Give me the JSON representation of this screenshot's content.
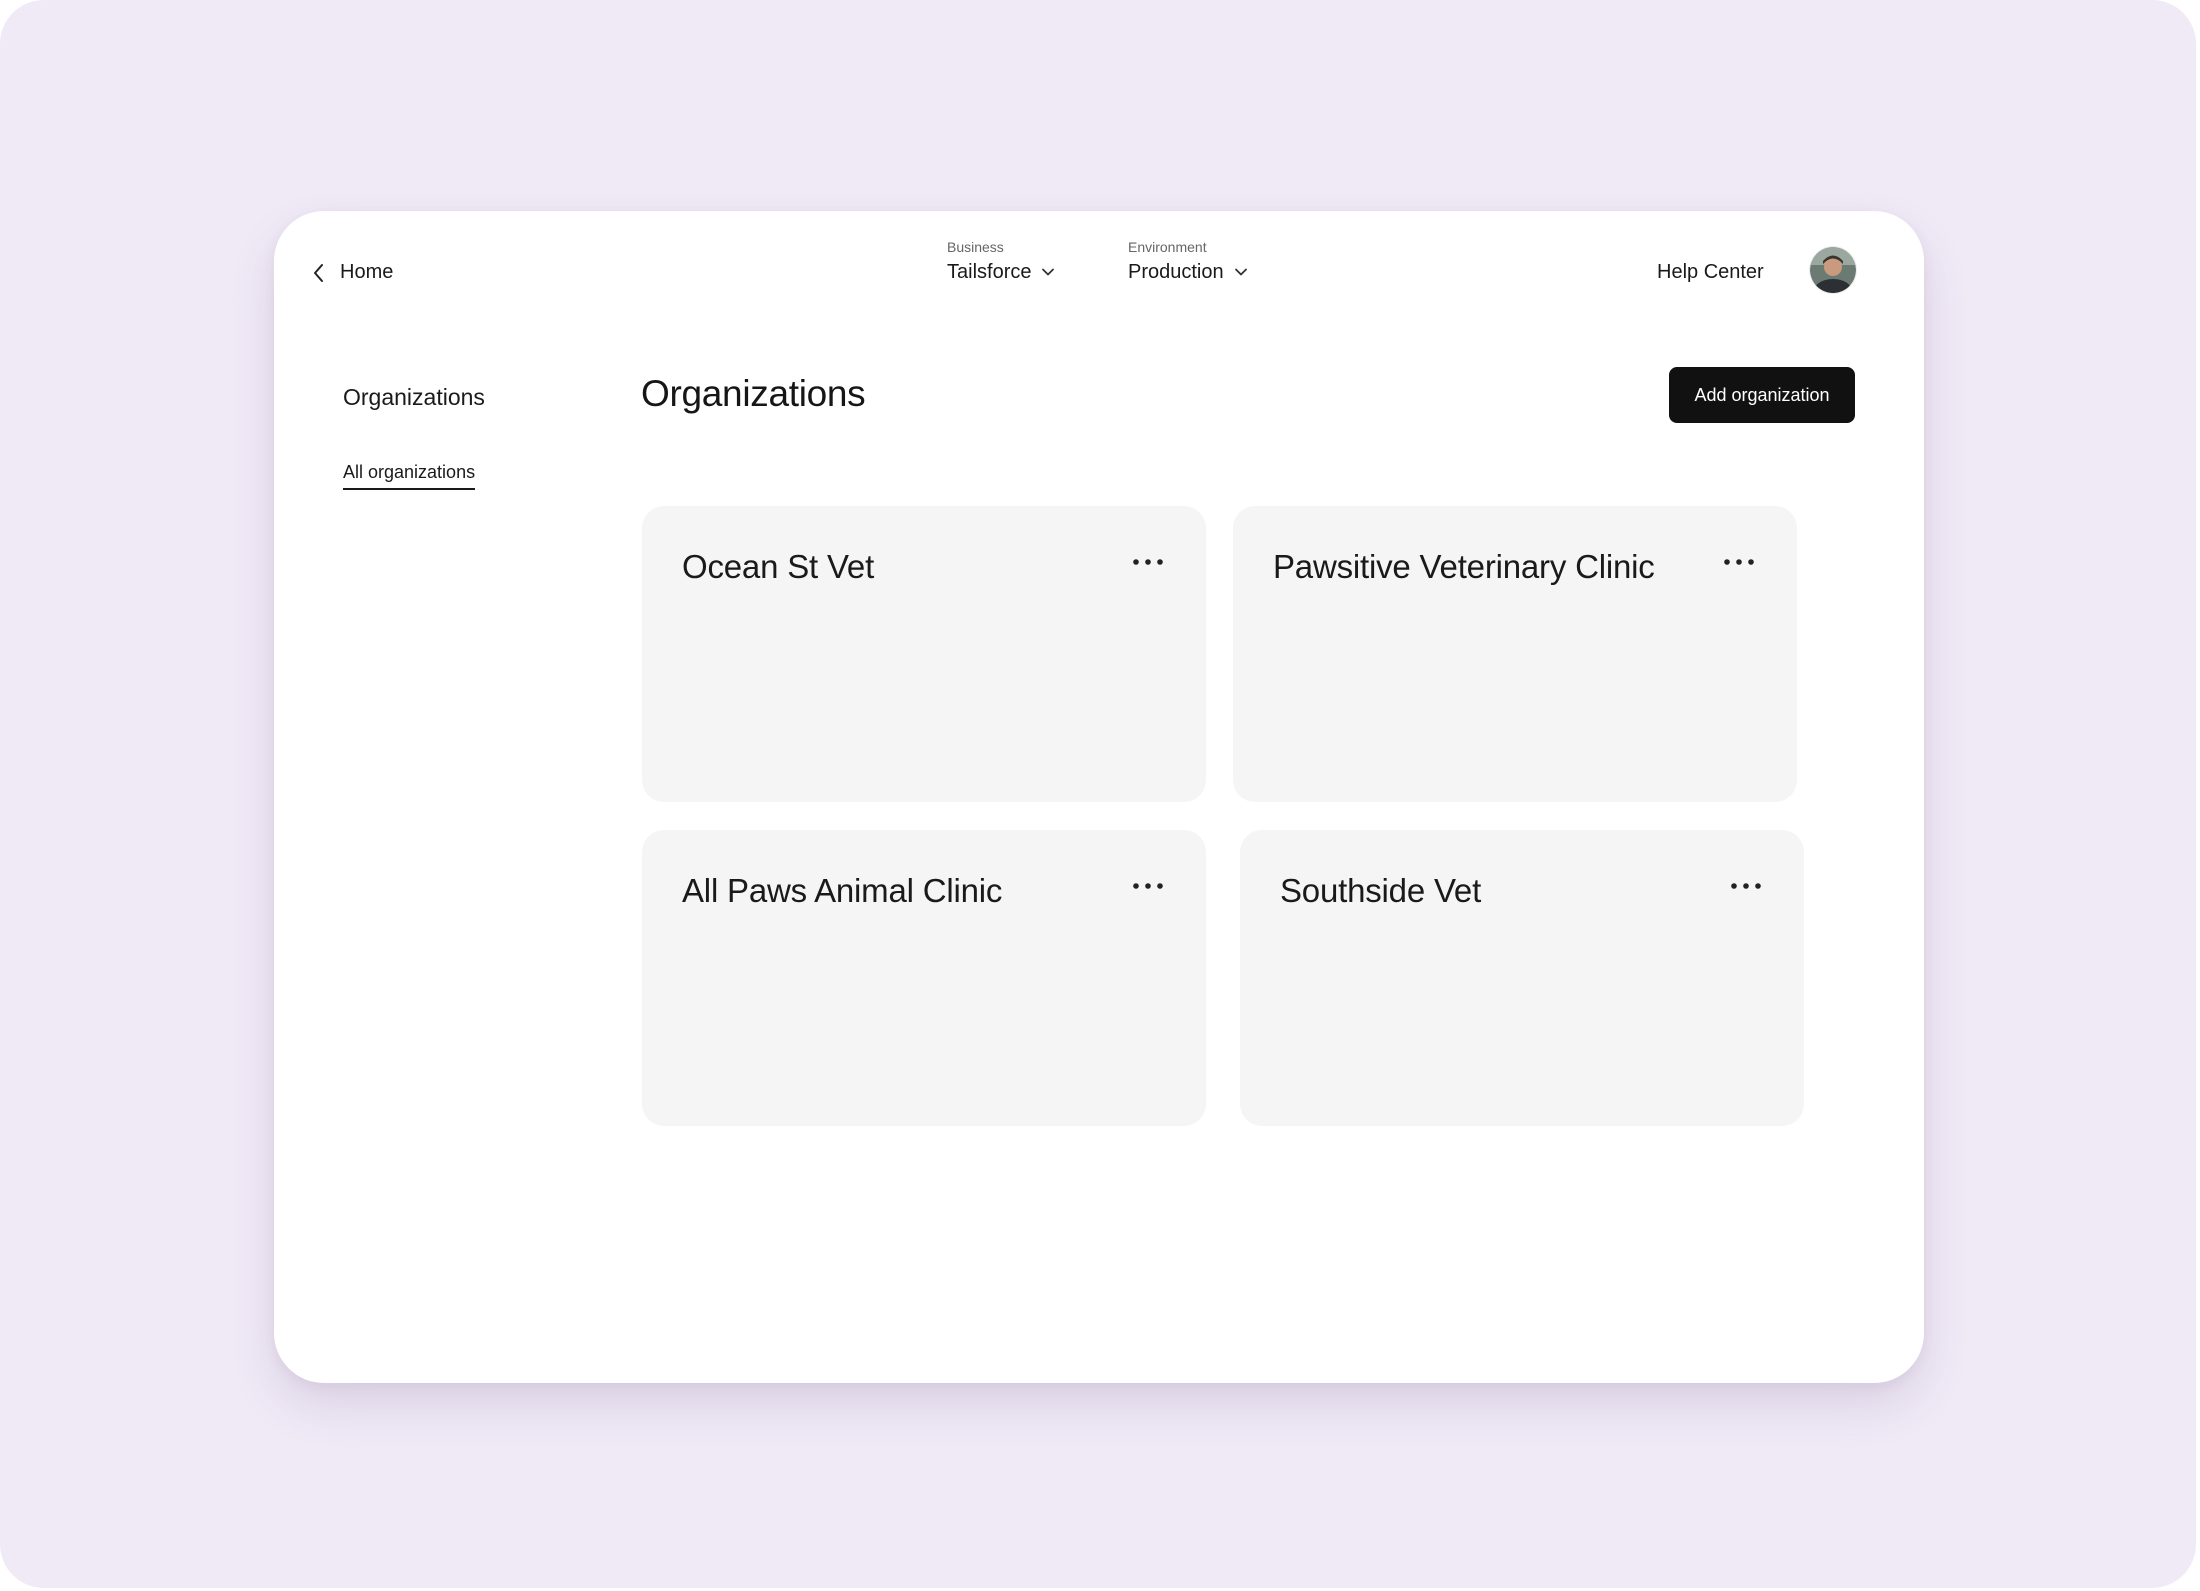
{
  "nav": {
    "home_label": "Home",
    "business_caption": "Business",
    "business_value": "Tailsforce",
    "environment_caption": "Environment",
    "environment_value": "Production",
    "help_label": "Help Center"
  },
  "sidebar": {
    "heading": "Organizations",
    "items": [
      {
        "label": "All organizations",
        "active": true
      }
    ]
  },
  "main": {
    "title": "Organizations",
    "add_button_label": "Add organization",
    "organizations": [
      {
        "name": "Ocean St Vet"
      },
      {
        "name": "Pawsitive Veterinary Clinic"
      },
      {
        "name": "All Paws Animal Clinic"
      },
      {
        "name": "Southside Vet"
      }
    ]
  },
  "colors": {
    "backdrop": "#f0e9f6",
    "window": "#ffffff",
    "card": "#f5f5f5",
    "primary_button": "#111111",
    "text": "#1a1a1a"
  },
  "icons": {
    "back": "chevron-left-icon",
    "dropdown": "chevron-down-icon",
    "more": "more-horizontal-icon",
    "avatar": "user-avatar"
  }
}
